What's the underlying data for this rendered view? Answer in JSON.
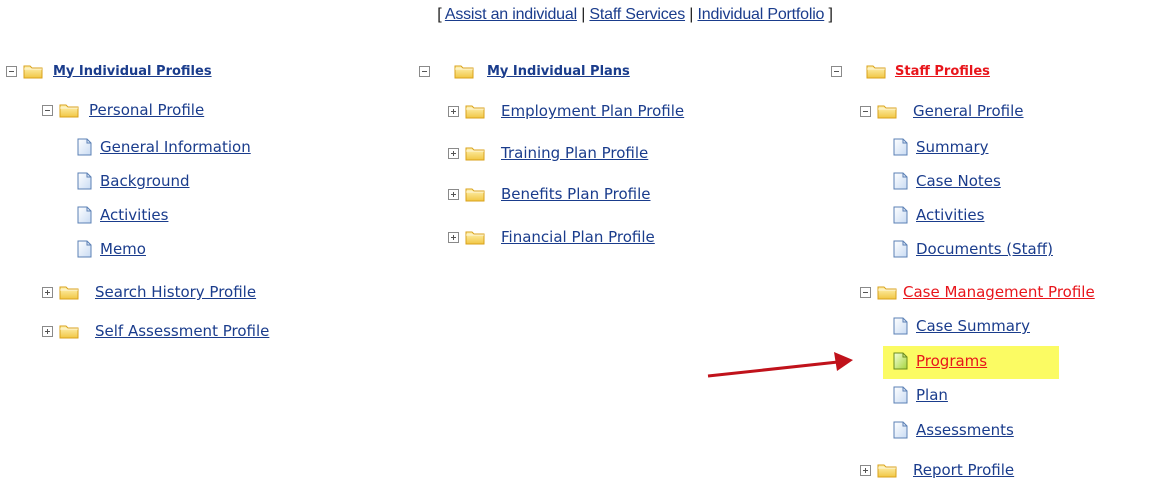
{
  "top_nav": {
    "open_bracket": "[",
    "sep": "|",
    "close_bracket": "]",
    "links": [
      "Assist an individual",
      "Staff Services",
      "Individual Portfolio"
    ]
  },
  "columns": {
    "individual_profiles": {
      "title": "My Individual Profiles",
      "personal_profile": {
        "label": "Personal Profile",
        "items": [
          "General Information",
          "Background",
          "Activities",
          "Memo"
        ]
      },
      "collapsed": [
        "Search History Profile",
        "Self Assessment Profile"
      ]
    },
    "individual_plans": {
      "title": "My Individual Plans",
      "collapsed": [
        "Employment Plan Profile",
        "Training Plan Profile",
        "Benefits Plan Profile",
        "Financial Plan Profile"
      ]
    },
    "staff_profiles": {
      "title": "Staff Profiles",
      "general_profile": {
        "label": "General Profile",
        "items": [
          "Summary",
          "Case Notes",
          "Activities",
          "Documents (Staff)"
        ]
      },
      "case_management": {
        "label": "Case Management Profile",
        "items": [
          "Case Summary",
          "Programs",
          "Plan",
          "Assessments"
        ]
      },
      "report_profile": "Report Profile"
    }
  },
  "colors": {
    "link": "#1a3c8c",
    "active_link": "#e8151b",
    "highlight": "#fbfb63",
    "arrow": "#c0121b"
  }
}
